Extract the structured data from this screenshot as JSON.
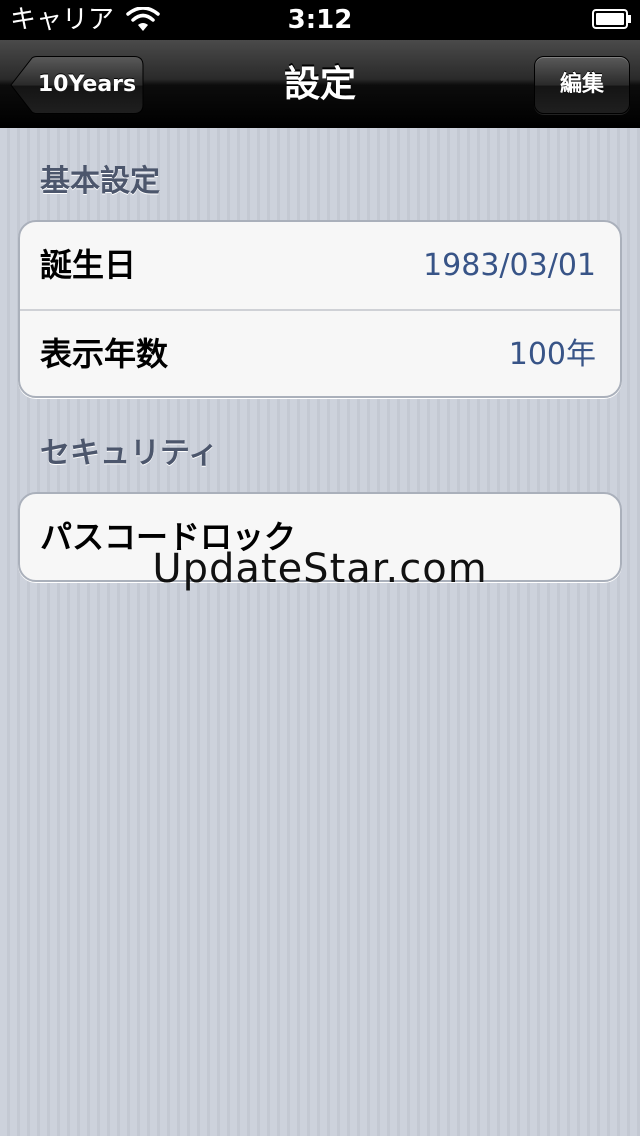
{
  "status_bar": {
    "carrier": "キャリア",
    "time": "3:12"
  },
  "nav": {
    "back_label": "10Years",
    "title": "設定",
    "edit_label": "編集"
  },
  "sections": [
    {
      "header": "基本設定",
      "rows": [
        {
          "label": "誕生日",
          "value": "1983/03/01"
        },
        {
          "label": "表示年数",
          "value": "100年"
        }
      ]
    },
    {
      "header": "セキュリティ",
      "rows": [
        {
          "label": "パスコードロック"
        }
      ]
    }
  ],
  "watermark": "UpdateStar.com",
  "colors": {
    "value_text": "#385487",
    "section_header": "#4c566c"
  }
}
